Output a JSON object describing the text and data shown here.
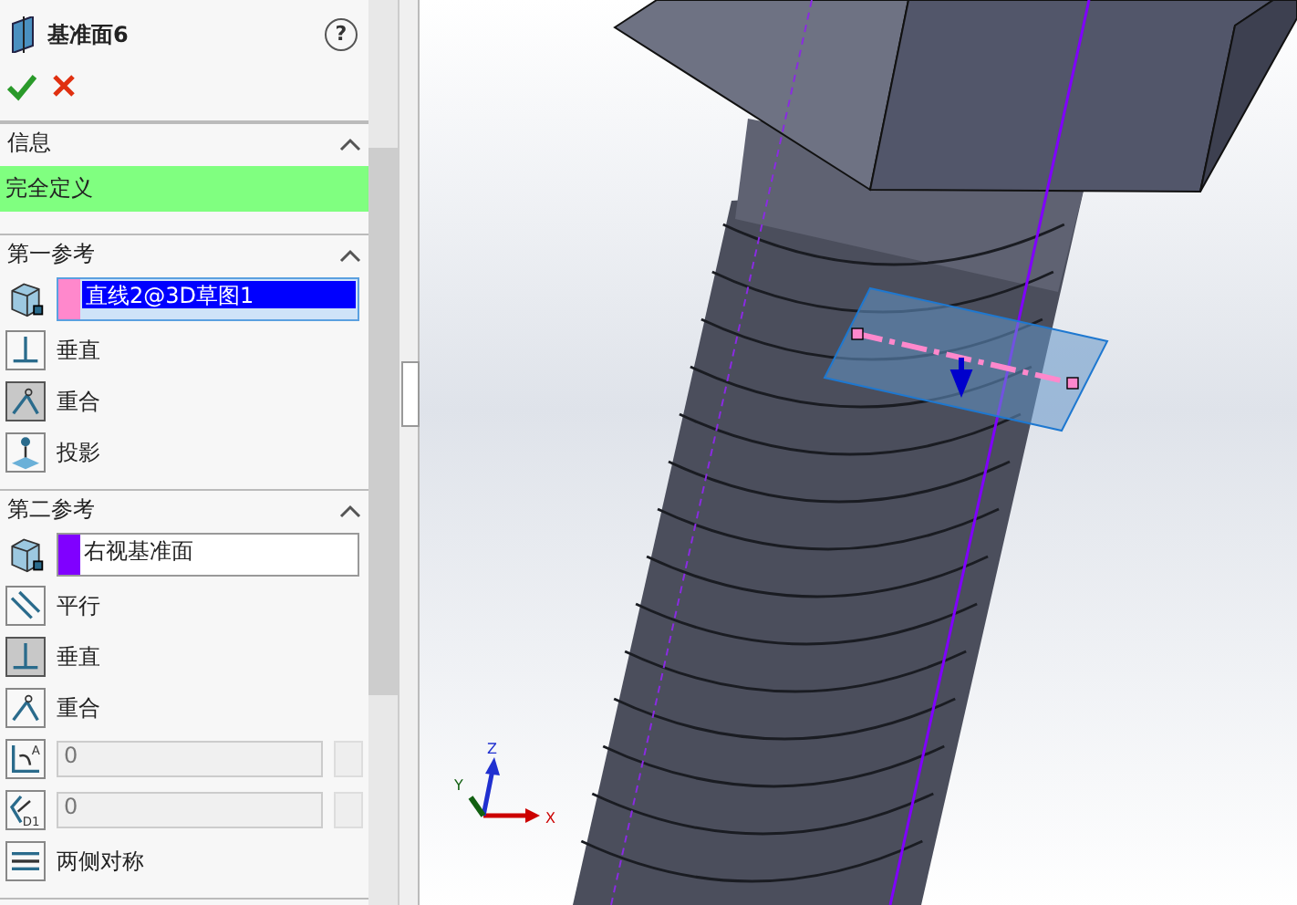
{
  "feature": {
    "title": "基准面6",
    "help": "?"
  },
  "viewport": {
    "axes": [
      {
        "kind": "x",
        "label": "X"
      },
      {
        "kind": "y",
        "label": "Y"
      },
      {
        "kind": "z",
        "label": "Z"
      }
    ]
  },
  "sections": [
    {
      "kind": "message",
      "title": "信息",
      "expanded": true,
      "message": "完全定义"
    },
    {
      "kind": "reference",
      "title": "第一参考",
      "expanded": true,
      "reference": {
        "value": "直线2@3D草图1",
        "color": "#ff88cc",
        "selected": true
      },
      "options": [
        {
          "kind": "perpendicular",
          "label": "垂直",
          "selected": false
        },
        {
          "kind": "coincident",
          "label": "重合",
          "selected": true
        },
        {
          "kind": "projection",
          "label": "投影",
          "selected": false
        }
      ]
    },
    {
      "kind": "reference",
      "title": "第二参考",
      "expanded": true,
      "reference": {
        "value": "右视基准面",
        "color": "#8000ff",
        "selected": false
      },
      "options": [
        {
          "kind": "parallel",
          "label": "平行",
          "selected": false
        },
        {
          "kind": "perpendicular",
          "label": "垂直",
          "selected": true
        },
        {
          "kind": "coincident",
          "label": "重合",
          "selected": false
        },
        {
          "kind": "angle",
          "icon_label": "A",
          "value": "0",
          "disabled": true
        },
        {
          "kind": "distance",
          "icon_label": "D1",
          "value": "0",
          "disabled": true
        },
        {
          "kind": "symmetric",
          "label": "两侧对称",
          "selected": false
        }
      ]
    }
  ]
}
